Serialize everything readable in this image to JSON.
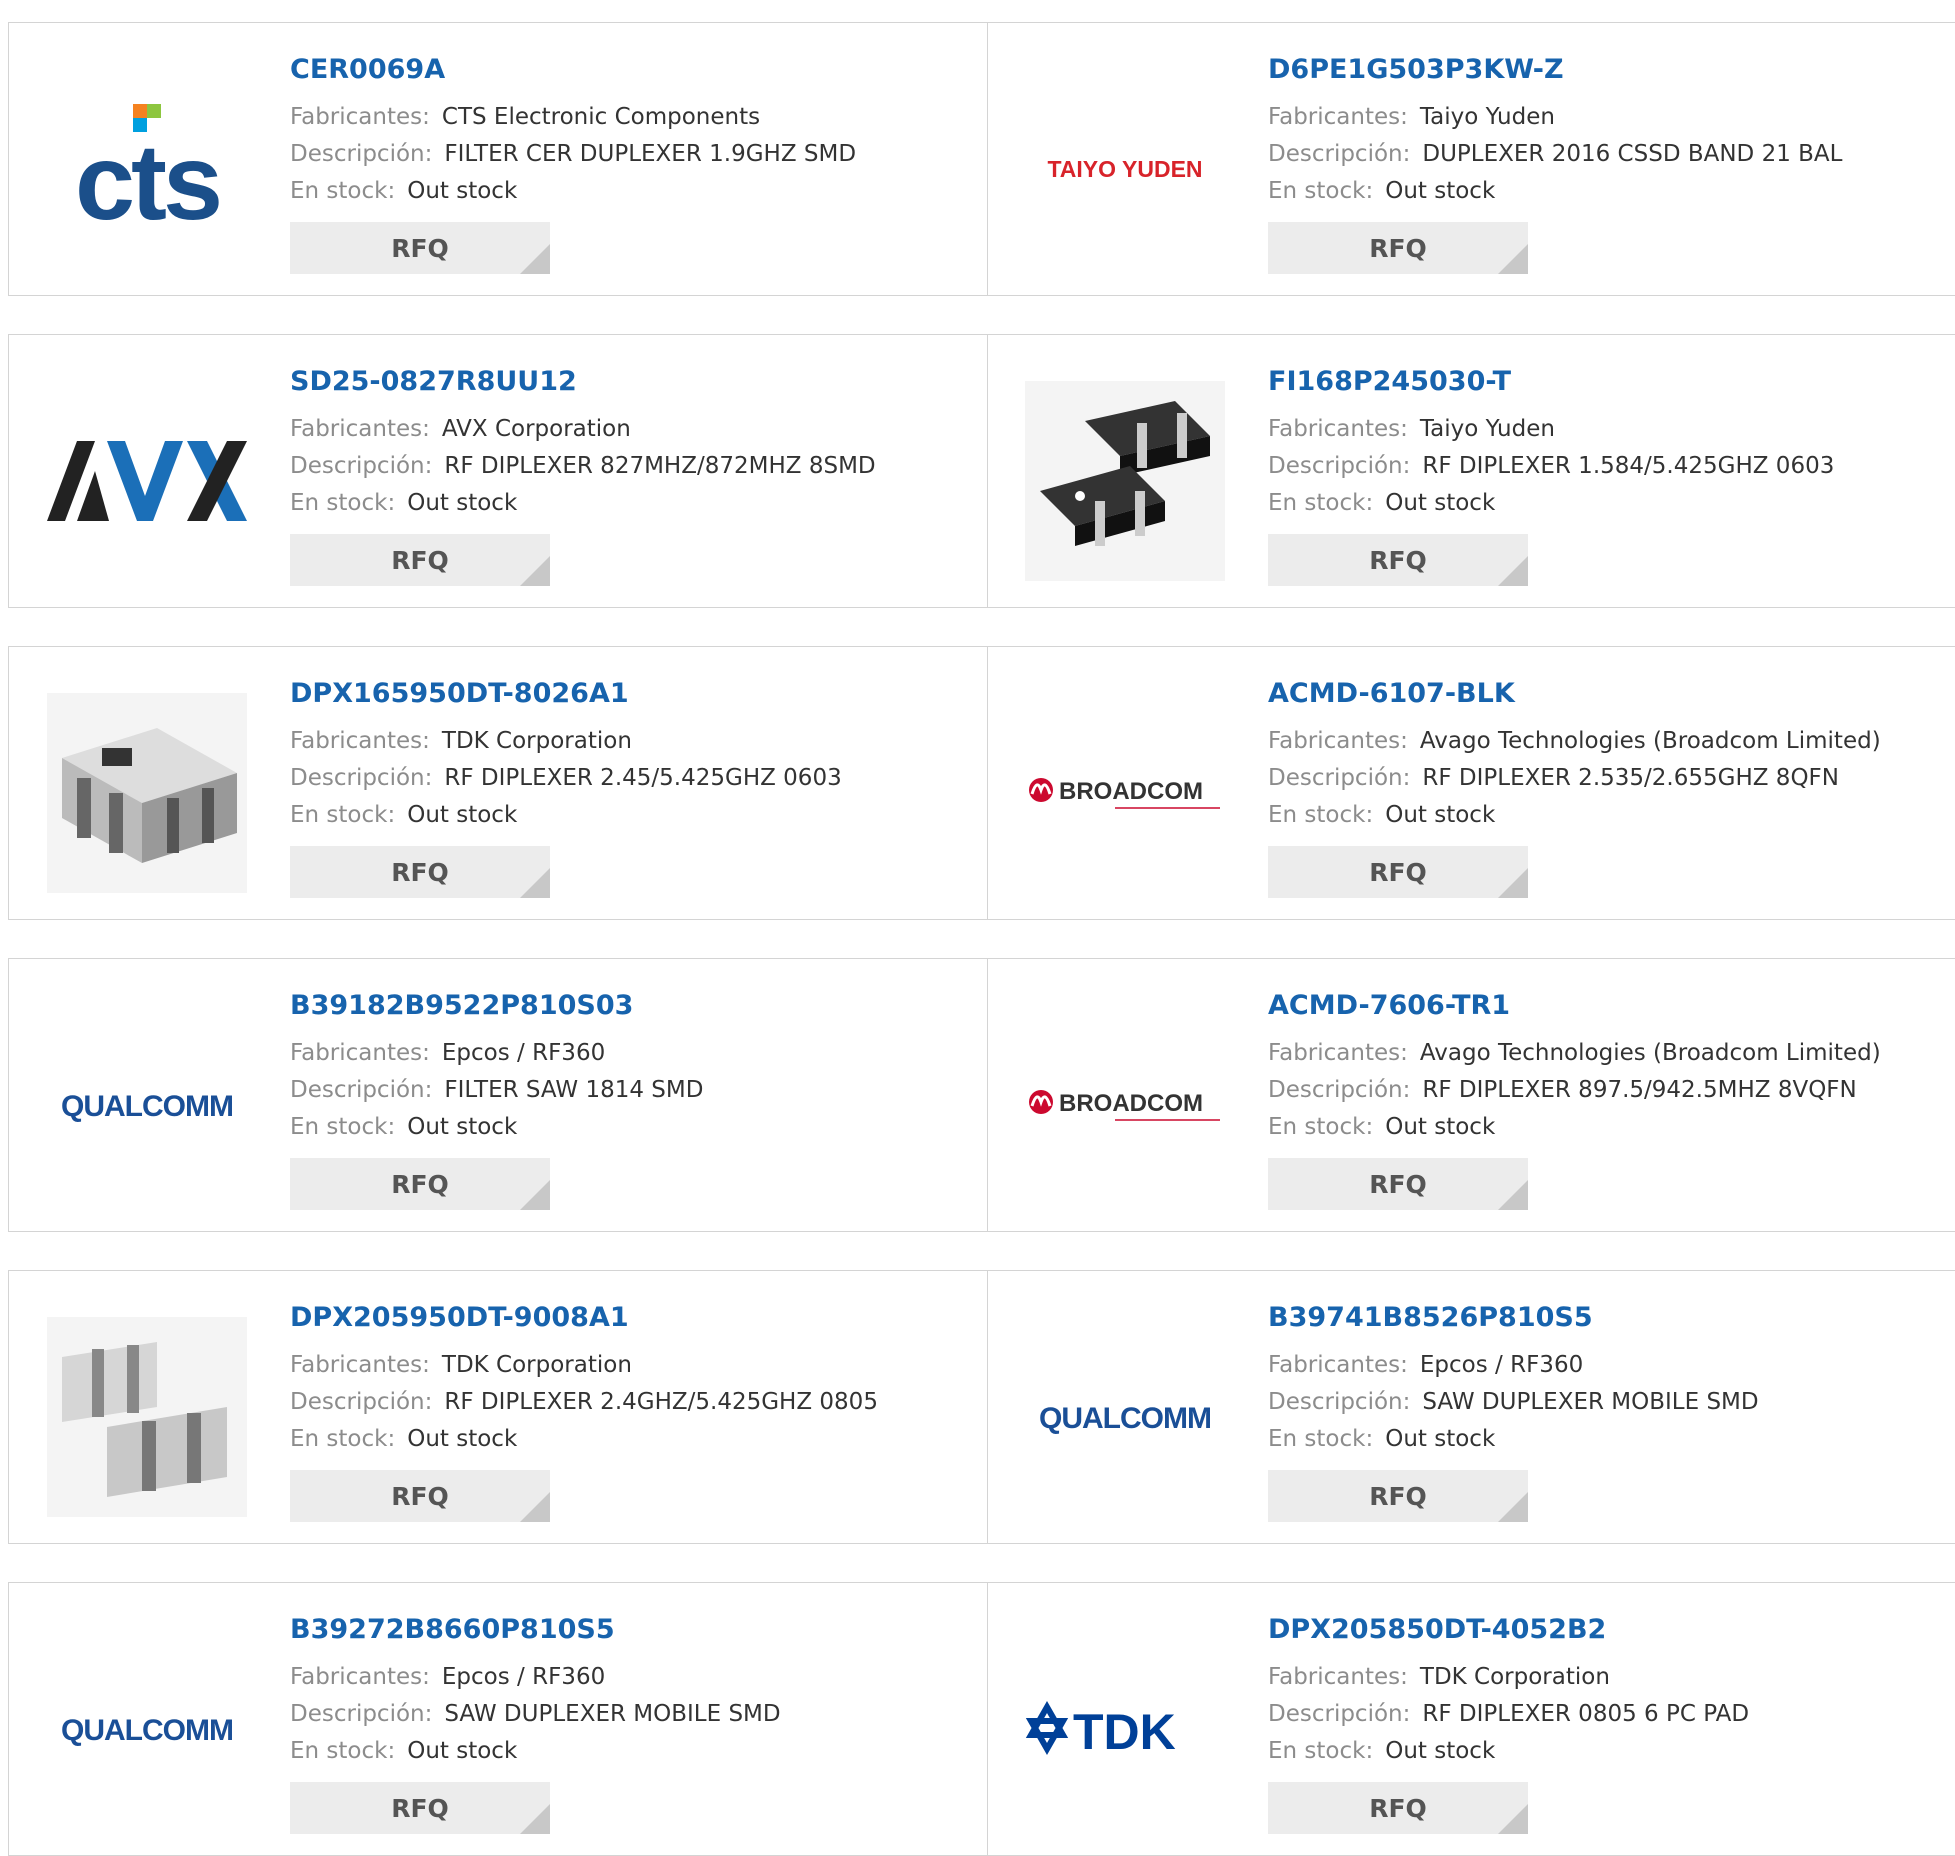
{
  "labels": {
    "manufacturer": "Fabricantes:",
    "description": "Descripción:",
    "stock": "En stock:",
    "rfq": "RFQ"
  },
  "rows": [
    [
      {
        "part": "CER0069A",
        "manufacturer": "CTS Electronic Components",
        "description": "FILTER CER DUPLEXER 1.9GHZ SMD",
        "stock": "Out stock",
        "logo": "cts-logo",
        "logo_text": "CTS"
      },
      {
        "part": "D6PE1G503P3KW-Z",
        "manufacturer": "Taiyo Yuden",
        "description": "DUPLEXER 2016 CSSD BAND 21 BAL",
        "stock": "Out stock",
        "logo": "taiyo-yuden-logo",
        "logo_text": "TAIYO YUDEN"
      }
    ],
    [
      {
        "part": "SD25-0827R8UU12",
        "manufacturer": "AVX Corporation",
        "description": "RF DIPLEXER 827MHZ/872MHZ 8SMD",
        "stock": "Out stock",
        "logo": "avx-logo",
        "logo_text": "AVX"
      },
      {
        "part": "FI168P245030-T",
        "manufacturer": "Taiyo Yuden",
        "description": "RF DIPLEXER 1.584/5.425GHZ 0603",
        "stock": "Out stock",
        "logo": "chip-photo-black",
        "logo_text": ""
      }
    ],
    [
      {
        "part": "DPX165950DT-8026A1",
        "manufacturer": "TDK Corporation",
        "description": "RF DIPLEXER 2.45/5.425GHZ 0603",
        "stock": "Out stock",
        "logo": "chip-photo-gray",
        "logo_text": ""
      },
      {
        "part": "ACMD-6107-BLK",
        "manufacturer": "Avago Technologies (Broadcom Limited)",
        "description": "RF DIPLEXER 2.535/2.655GHZ 8QFN",
        "stock": "Out stock",
        "logo": "broadcom-logo",
        "logo_text": "BROADCOM"
      }
    ],
    [
      {
        "part": "B39182B9522P810S03",
        "manufacturer": "Epcos / RF360",
        "description": "FILTER SAW 1814 SMD",
        "stock": "Out stock",
        "logo": "qualcomm-logo",
        "logo_text": "QUALCOMM"
      },
      {
        "part": "ACMD-7606-TR1",
        "manufacturer": "Avago Technologies (Broadcom Limited)",
        "description": "RF DIPLEXER 897.5/942.5MHZ 8VQFN",
        "stock": "Out stock",
        "logo": "broadcom-logo",
        "logo_text": "BROADCOM"
      }
    ],
    [
      {
        "part": "DPX205950DT-9008A1",
        "manufacturer": "TDK Corporation",
        "description": "RF DIPLEXER 2.4GHZ/5.425GHZ 0805",
        "stock": "Out stock",
        "logo": "chip-photo-double",
        "logo_text": ""
      },
      {
        "part": "B39741B8526P810S5",
        "manufacturer": "Epcos / RF360",
        "description": "SAW DUPLEXER MOBILE SMD",
        "stock": "Out stock",
        "logo": "qualcomm-logo",
        "logo_text": "QUALCOMM"
      }
    ],
    [
      {
        "part": "B39272B8660P810S5",
        "manufacturer": "Epcos / RF360",
        "description": "SAW DUPLEXER MOBILE SMD",
        "stock": "Out stock",
        "logo": "qualcomm-logo",
        "logo_text": "QUALCOMM"
      },
      {
        "part": "DPX205850DT-4052B2",
        "manufacturer": "TDK Corporation",
        "description": "RF DIPLEXER 0805 6 PC PAD",
        "stock": "Out stock",
        "logo": "tdk-logo",
        "logo_text": "TDK"
      }
    ]
  ],
  "colors": {
    "link": "#1763ad",
    "label": "#8c8c8c",
    "border": "#d4d4d4",
    "button_bg": "#ececec"
  }
}
